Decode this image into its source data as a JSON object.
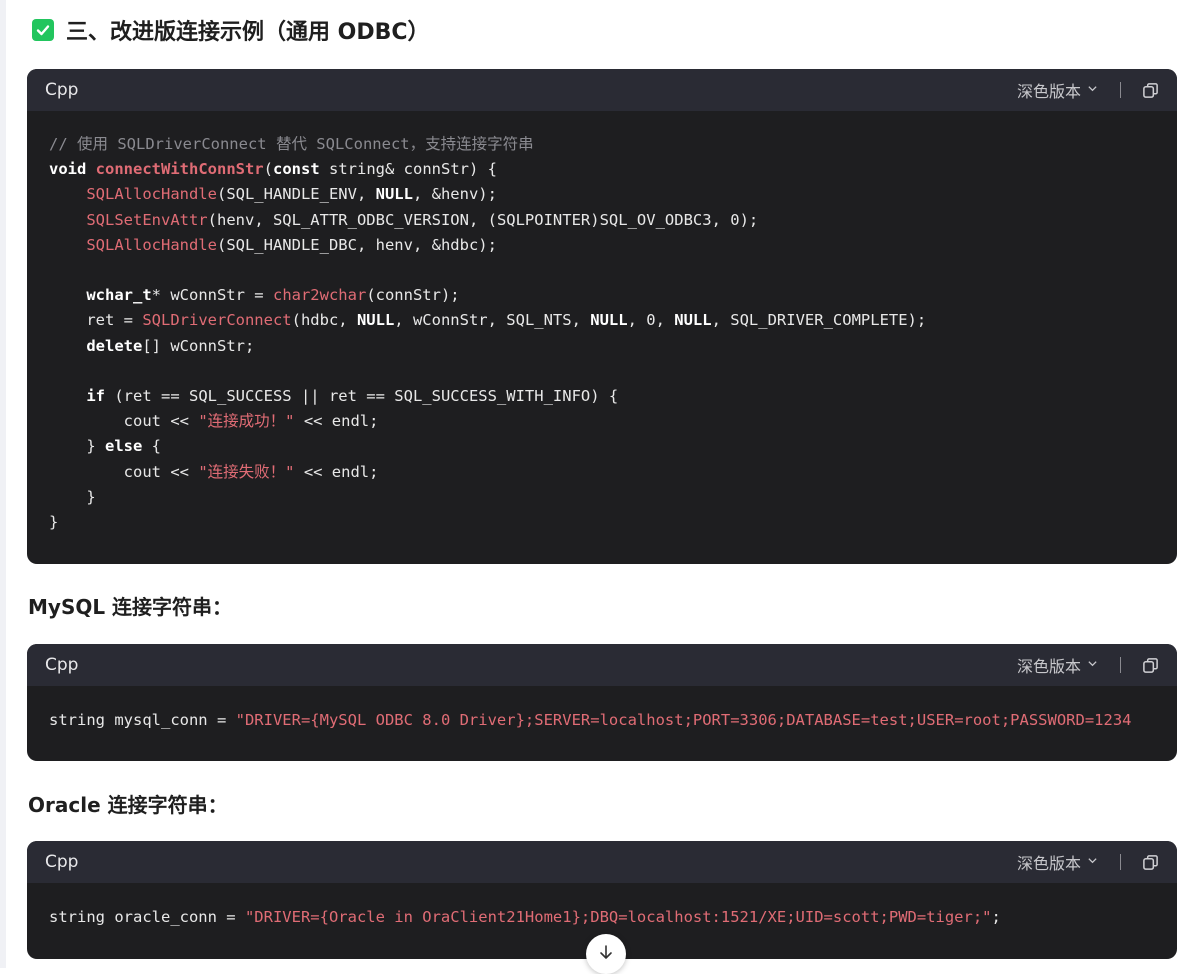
{
  "heading": {
    "title": "三、改进版连接示例（通用 ODBC）"
  },
  "code_blocks": [
    {
      "lang": "Cpp",
      "theme_label": "深色版本",
      "lines": [
        {
          "tokens": [
            {
              "t": "comment",
              "v": "// 使用 SQLDriverConnect 替代 SQLConnect，支持连接字符串"
            }
          ]
        },
        {
          "tokens": [
            {
              "t": "kw",
              "v": "void"
            },
            {
              "t": "plain",
              "v": " "
            },
            {
              "t": "fnbold",
              "v": "connectWithConnStr"
            },
            {
              "t": "plain",
              "v": "("
            },
            {
              "t": "kw",
              "v": "const"
            },
            {
              "t": "plain",
              "v": " string& connStr) {"
            }
          ]
        },
        {
          "tokens": [
            {
              "t": "plain",
              "v": "    "
            },
            {
              "t": "fn",
              "v": "SQLAllocHandle"
            },
            {
              "t": "plain",
              "v": "(SQL_HANDLE_ENV, "
            },
            {
              "t": "kw",
              "v": "NULL"
            },
            {
              "t": "plain",
              "v": ", &henv);"
            }
          ]
        },
        {
          "tokens": [
            {
              "t": "plain",
              "v": "    "
            },
            {
              "t": "fn",
              "v": "SQLSetEnvAttr"
            },
            {
              "t": "plain",
              "v": "(henv, SQL_ATTR_ODBC_VERSION, (SQLPOINTER)SQL_OV_ODBC3, 0);"
            }
          ]
        },
        {
          "tokens": [
            {
              "t": "plain",
              "v": "    "
            },
            {
              "t": "fn",
              "v": "SQLAllocHandle"
            },
            {
              "t": "plain",
              "v": "(SQL_HANDLE_DBC, henv, &hdbc);"
            }
          ]
        },
        {
          "tokens": []
        },
        {
          "tokens": [
            {
              "t": "plain",
              "v": "    "
            },
            {
              "t": "kw",
              "v": "wchar_t"
            },
            {
              "t": "plain",
              "v": "* wConnStr = "
            },
            {
              "t": "fn",
              "v": "char2wchar"
            },
            {
              "t": "plain",
              "v": "(connStr);"
            }
          ]
        },
        {
          "tokens": [
            {
              "t": "plain",
              "v": "    ret = "
            },
            {
              "t": "fn",
              "v": "SQLDriverConnect"
            },
            {
              "t": "plain",
              "v": "(hdbc, "
            },
            {
              "t": "kw",
              "v": "NULL"
            },
            {
              "t": "plain",
              "v": ", wConnStr, SQL_NTS, "
            },
            {
              "t": "kw",
              "v": "NULL"
            },
            {
              "t": "plain",
              "v": ", 0, "
            },
            {
              "t": "kw",
              "v": "NULL"
            },
            {
              "t": "plain",
              "v": ", SQL_DRIVER_COMPLETE);"
            }
          ]
        },
        {
          "tokens": [
            {
              "t": "plain",
              "v": "    "
            },
            {
              "t": "kw",
              "v": "delete"
            },
            {
              "t": "plain",
              "v": "[] wConnStr;"
            }
          ]
        },
        {
          "tokens": []
        },
        {
          "tokens": [
            {
              "t": "plain",
              "v": "    "
            },
            {
              "t": "kw",
              "v": "if"
            },
            {
              "t": "plain",
              "v": " (ret == SQL_SUCCESS || ret == SQL_SUCCESS_WITH_INFO) {"
            }
          ]
        },
        {
          "tokens": [
            {
              "t": "plain",
              "v": "        cout << "
            },
            {
              "t": "str",
              "v": "\"连接成功！\""
            },
            {
              "t": "plain",
              "v": " << endl;"
            }
          ]
        },
        {
          "tokens": [
            {
              "t": "plain",
              "v": "    } "
            },
            {
              "t": "kw",
              "v": "else"
            },
            {
              "t": "plain",
              "v": " {"
            }
          ]
        },
        {
          "tokens": [
            {
              "t": "plain",
              "v": "        cout << "
            },
            {
              "t": "str",
              "v": "\"连接失败！\""
            },
            {
              "t": "plain",
              "v": " << endl;"
            }
          ]
        },
        {
          "tokens": [
            {
              "t": "plain",
              "v": "    }"
            }
          ]
        },
        {
          "tokens": [
            {
              "t": "plain",
              "v": "}"
            }
          ]
        }
      ]
    },
    {
      "lang": "Cpp",
      "theme_label": "深色版本",
      "lines": [
        {
          "tokens": [
            {
              "t": "plain",
              "v": "string mysql_conn = "
            },
            {
              "t": "str",
              "v": "\"DRIVER={MySQL ODBC 8.0 Driver};SERVER=localhost;PORT=3306;DATABASE=test;USER=root;PASSWORD=1234"
            }
          ]
        }
      ]
    },
    {
      "lang": "Cpp",
      "theme_label": "深色版本",
      "lines": [
        {
          "tokens": [
            {
              "t": "plain",
              "v": "string oracle_conn = "
            },
            {
              "t": "str",
              "v": "\"DRIVER={Oracle in OraClient21Home1};DBQ=localhost:1521/XE;UID=scott;PWD=tiger;\""
            },
            {
              "t": "plain",
              "v": ";"
            }
          ]
        }
      ]
    }
  ],
  "subheadings": {
    "mysql": "MySQL 连接字符串：",
    "oracle": "Oracle 连接字符串："
  },
  "colors": {
    "check_green": "#22c55e",
    "code_bg": "#1e1e20",
    "code_header_bg": "#2a2b34",
    "token_red": "#e06c75",
    "comment_gray": "#8a8a90"
  },
  "icons": [
    "check-square-icon",
    "chevron-down-icon",
    "copy-icon",
    "arrow-down-icon"
  ]
}
